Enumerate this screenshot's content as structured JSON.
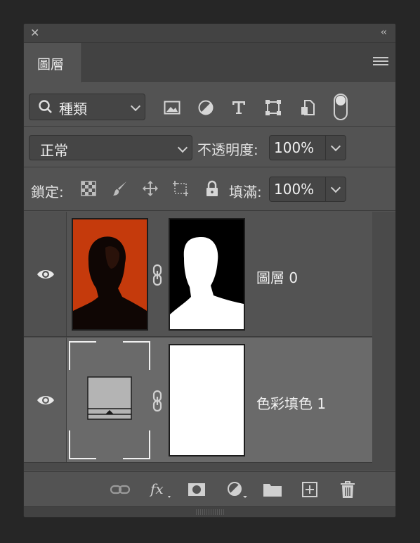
{
  "window": {
    "close_icon": "close-icon",
    "collapse_icon": "double-chevron-left-icon"
  },
  "tabs": [
    {
      "label": "圖層"
    }
  ],
  "filter": {
    "selected": "種類",
    "icons": [
      "image-filter-icon",
      "adjustment-filter-icon",
      "type-filter-icon",
      "shape-filter-icon",
      "smart-object-filter-icon"
    ]
  },
  "blend": {
    "mode": "正常",
    "opacity_label": "不透明度:",
    "opacity_value": "100%"
  },
  "lock": {
    "label": "鎖定:",
    "fill_label": "填滿:",
    "fill_value": "100%"
  },
  "layers": [
    {
      "name": "圖層 0",
      "visible": true
    },
    {
      "name": "色彩填色 1",
      "visible": true,
      "selected": true
    }
  ],
  "colors": {
    "photo_bg": "#c53a0c",
    "panel": "#535353",
    "selected_layer": "#6a6a6a"
  },
  "bottom_icons": [
    "link-layers-icon",
    "fx-icon",
    "mask-icon",
    "adjustment-layer-icon",
    "group-folder-icon",
    "new-layer-icon",
    "trash-icon"
  ]
}
